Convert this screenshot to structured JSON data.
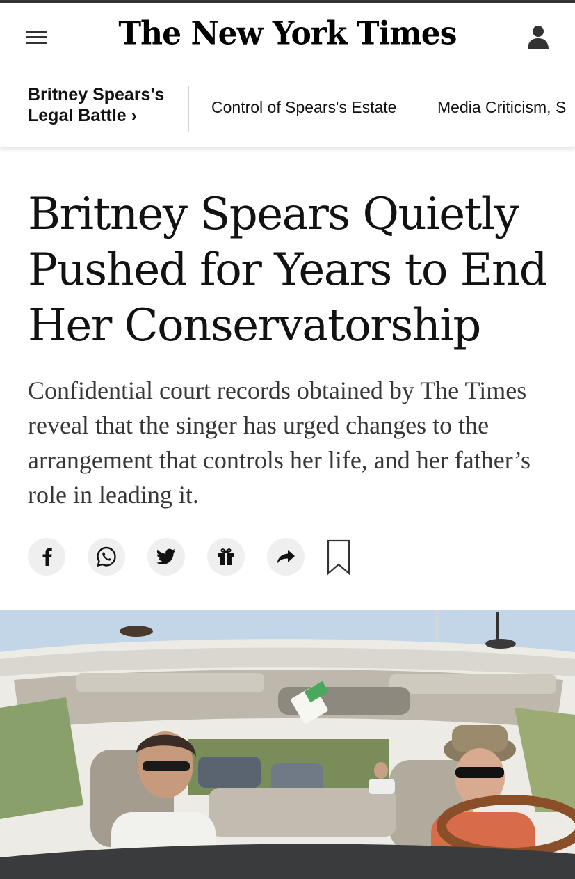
{
  "header": {
    "logo": "The New York Times"
  },
  "nav": {
    "title": "Britney Spears's Legal Battle ›",
    "links": [
      "Control of Spears's Estate",
      "Media Criticism, S"
    ]
  },
  "article": {
    "headline": "Britney Spears Quietly Pushed for Years to End Her Conservatorship",
    "summary": "Confidential court records obtained by The Times reveal that the singer has urged changes to the arrangement that controls her life, and her father’s role in leading it."
  },
  "share": {
    "icons": [
      "facebook-icon",
      "whatsapp-icon",
      "twitter-icon",
      "gift-icon",
      "share-icon",
      "bookmark-icon"
    ]
  },
  "colors": {
    "text": "#121212",
    "summary_text": "#363636",
    "button_bg": "#efefef",
    "top_strip": "#333333"
  }
}
